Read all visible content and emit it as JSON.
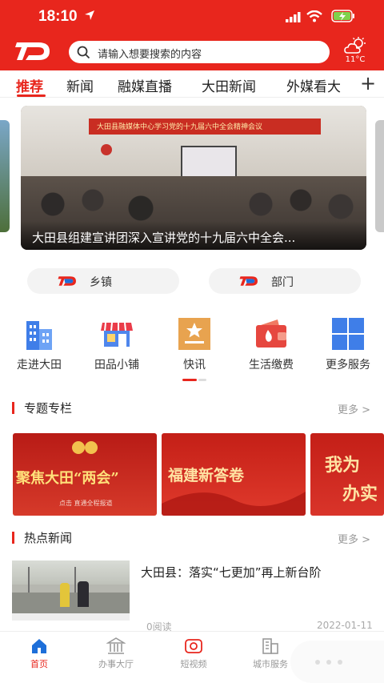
{
  "status": {
    "time": "18:10"
  },
  "header": {
    "search_placeholder": "请输入想要搜索的内容",
    "weather_temp": "11°C",
    "brand_color": "#e8261d"
  },
  "tabs": [
    {
      "label": "推荐",
      "active": true
    },
    {
      "label": "新闻"
    },
    {
      "label": "融媒直播"
    },
    {
      "label": "大田新闻"
    },
    {
      "label": "外媒看大"
    }
  ],
  "banner": {
    "caption": "大田县组建宣讲团深入宣讲党的十九届六中全会...",
    "meeting_banner_text": "大田县融媒体中心学习党的十九届六中全会精神会议"
  },
  "quick_links": [
    {
      "label": "乡镇"
    },
    {
      "label": "部门"
    }
  ],
  "services": [
    {
      "label": "走进大田",
      "icon": "buildings-icon"
    },
    {
      "label": "田品小铺",
      "icon": "shop-icon"
    },
    {
      "label": "快讯",
      "icon": "star-board-icon"
    },
    {
      "label": "生活缴费",
      "icon": "wallet-icon"
    },
    {
      "label": "更多服务",
      "icon": "grid-icon"
    }
  ],
  "topics": {
    "title": "专题专栏",
    "more": "更多 >",
    "cards": [
      {
        "text": "聚焦大田“两会”",
        "sub": "点击 直通全程报道"
      },
      {
        "text": "福建新答卷"
      },
      {
        "text": "我为",
        "text2": "办实"
      }
    ]
  },
  "hot_news": {
    "title": "热点新闻",
    "more": "更多 >",
    "items": [
      {
        "title": "大田县：落实“七更加”再上新台阶",
        "reads": "0阅读",
        "date": "2022-01-11"
      }
    ]
  },
  "bottom_nav": [
    {
      "label": "首页",
      "icon": "home-icon",
      "active": true
    },
    {
      "label": "办事大厅",
      "icon": "government-hall-icon"
    },
    {
      "label": "短视频",
      "icon": "video-icon"
    },
    {
      "label": "城市服务",
      "icon": "city-icon"
    }
  ]
}
